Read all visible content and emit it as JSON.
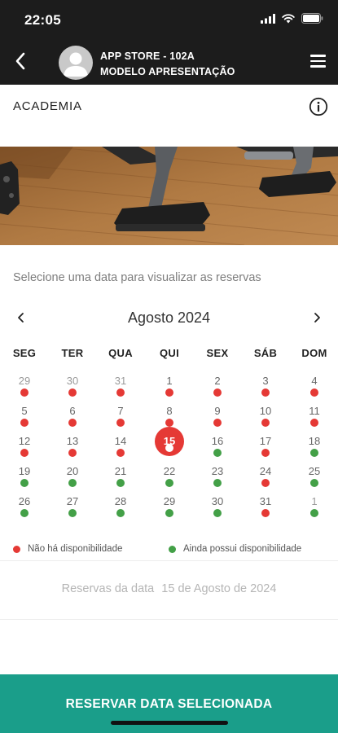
{
  "status_bar": {
    "time": "22:05",
    "icons": [
      "signal-icon",
      "wifi-icon",
      "battery-icon"
    ]
  },
  "header": {
    "line1": "APP STORE - 102A",
    "line2": "MODELO APRESENTAÇÃO"
  },
  "section": {
    "title": "ACADEMIA"
  },
  "prompt": "Selecione uma data para visualizar as reservas",
  "calendar": {
    "month_label": "Agosto 2024",
    "weekdays": [
      "SEG",
      "TER",
      "QUA",
      "QUI",
      "SEX",
      "SÁB",
      "DOM"
    ],
    "weeks": [
      [
        {
          "n": "29",
          "o": true,
          "s": "red"
        },
        {
          "n": "30",
          "o": true,
          "s": "red"
        },
        {
          "n": "31",
          "o": true,
          "s": "red"
        },
        {
          "n": "1",
          "s": "red"
        },
        {
          "n": "2",
          "s": "red"
        },
        {
          "n": "3",
          "s": "red"
        },
        {
          "n": "4",
          "s": "red"
        }
      ],
      [
        {
          "n": "5",
          "s": "red"
        },
        {
          "n": "6",
          "s": "red"
        },
        {
          "n": "7",
          "s": "red"
        },
        {
          "n": "8",
          "s": "red"
        },
        {
          "n": "9",
          "s": "red"
        },
        {
          "n": "10",
          "s": "red"
        },
        {
          "n": "11",
          "s": "red"
        }
      ],
      [
        {
          "n": "12",
          "s": "red"
        },
        {
          "n": "13",
          "s": "red"
        },
        {
          "n": "14",
          "s": "red"
        },
        {
          "n": "15",
          "s": "red",
          "sel": true
        },
        {
          "n": "16",
          "s": "green"
        },
        {
          "n": "17",
          "s": "red"
        },
        {
          "n": "18",
          "s": "green"
        }
      ],
      [
        {
          "n": "19",
          "s": "green"
        },
        {
          "n": "20",
          "s": "green"
        },
        {
          "n": "21",
          "s": "green"
        },
        {
          "n": "22",
          "s": "green"
        },
        {
          "n": "23",
          "s": "green"
        },
        {
          "n": "24",
          "s": "red"
        },
        {
          "n": "25",
          "s": "green"
        }
      ],
      [
        {
          "n": "26",
          "s": "green"
        },
        {
          "n": "27",
          "s": "green"
        },
        {
          "n": "28",
          "s": "green"
        },
        {
          "n": "29",
          "s": "green"
        },
        {
          "n": "30",
          "s": "green"
        },
        {
          "n": "31",
          "s": "red"
        },
        {
          "n": "1",
          "o": true,
          "s": "green"
        }
      ]
    ]
  },
  "legend": {
    "unavailable": "Não há disponibilidade",
    "available": "Ainda possui disponibilidade"
  },
  "reserves": {
    "label": "Reservas da data",
    "date": "15 de Agosto de 2024"
  },
  "button": {
    "label": "RESERVAR DATA SELECIONADA"
  },
  "colors": {
    "header_bg": "#1c1c1c",
    "red": "#e53935",
    "green": "#43a047",
    "accent": "#1a9e8a"
  }
}
